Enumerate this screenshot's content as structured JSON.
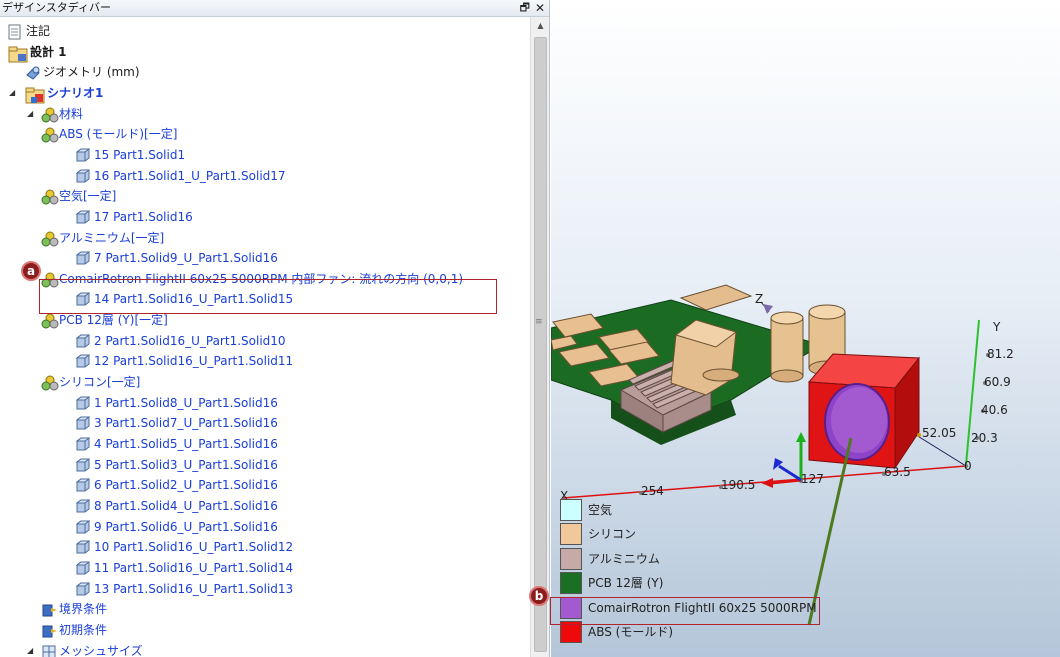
{
  "panel": {
    "title": "デザインスタディバー",
    "pin": "🗗",
    "close": "✕"
  },
  "tree": [
    {
      "label": "注記",
      "color": "black",
      "bold": false
    },
    {
      "label": "設計 1",
      "color": "black",
      "bold": true
    },
    {
      "label": "ジオメトリ (mm)",
      "color": "black",
      "bold": false
    },
    {
      "label": "シナリオ1",
      "color": "blue",
      "bold": true
    },
    {
      "label": "材料",
      "color": "blue",
      "bold": false
    },
    {
      "label": "ABS (モールド)[一定]",
      "color": "blue",
      "bold": false
    },
    {
      "label": "15 Part1.Solid1",
      "color": "blue",
      "bold": false
    },
    {
      "label": "16 Part1.Solid1_U_Part1.Solid17",
      "color": "blue",
      "bold": false
    },
    {
      "label": "空気[一定]",
      "color": "blue",
      "bold": false
    },
    {
      "label": "17 Part1.Solid16",
      "color": "blue",
      "bold": false
    },
    {
      "label": "アルミニウム[一定]",
      "color": "blue",
      "bold": false
    },
    {
      "label": "7 Part1.Solid9_U_Part1.Solid16",
      "color": "blue",
      "bold": false
    },
    {
      "label": "ComairRotron FlightII 60x25 5000RPM 内部ファン: 流れの方向 (0,0,1)",
      "color": "blue",
      "bold": false
    },
    {
      "label": "14 Part1.Solid16_U_Part1.Solid15",
      "color": "blue",
      "bold": false
    },
    {
      "label": "PCB 12層 (Y)[一定]",
      "color": "blue",
      "bold": false
    },
    {
      "label": "2 Part1.Solid16_U_Part1.Solid10",
      "color": "blue",
      "bold": false
    },
    {
      "label": "12 Part1.Solid16_U_Part1.Solid11",
      "color": "blue",
      "bold": false
    },
    {
      "label": "シリコン[一定]",
      "color": "blue",
      "bold": false
    },
    {
      "label": "1 Part1.Solid8_U_Part1.Solid16",
      "color": "blue",
      "bold": false
    },
    {
      "label": "3 Part1.Solid7_U_Part1.Solid16",
      "color": "blue",
      "bold": false
    },
    {
      "label": "4 Part1.Solid5_U_Part1.Solid16",
      "color": "blue",
      "bold": false
    },
    {
      "label": "5 Part1.Solid3_U_Part1.Solid16",
      "color": "blue",
      "bold": false
    },
    {
      "label": "6 Part1.Solid2_U_Part1.Solid16",
      "color": "blue",
      "bold": false
    },
    {
      "label": "8 Part1.Solid4_U_Part1.Solid16",
      "color": "blue",
      "bold": false
    },
    {
      "label": "9 Part1.Solid6_U_Part1.Solid16",
      "color": "blue",
      "bold": false
    },
    {
      "label": "10 Part1.Solid16_U_Part1.Solid12",
      "color": "blue",
      "bold": false
    },
    {
      "label": "11 Part1.Solid16_U_Part1.Solid14",
      "color": "blue",
      "bold": false
    },
    {
      "label": "13 Part1.Solid16_U_Part1.Solid13",
      "color": "blue",
      "bold": false
    },
    {
      "label": "境界条件",
      "color": "blue",
      "bold": false
    },
    {
      "label": "初期条件",
      "color": "blue",
      "bold": false
    },
    {
      "label": "メッシュサイズ",
      "color": "blue",
      "bold": false
    }
  ],
  "callouts": {
    "a": "a",
    "b": "b"
  },
  "axes": {
    "y_label": "Y",
    "z_label": "Z",
    "x_label": "X",
    "y_ticks": [
      "81.2",
      "60.9",
      "40.6",
      "20.3",
      "0"
    ],
    "x_ticks": [
      "254",
      "190.5",
      "127",
      "63.5"
    ],
    "z_tick": "52.05"
  },
  "legend": [
    {
      "label": "空気",
      "color": "#ccffff"
    },
    {
      "label": "シリコン",
      "color": "#f1c89a"
    },
    {
      "label": "アルミニウム",
      "color": "#c6aaa8"
    },
    {
      "label": "PCB 12層 (Y)",
      "color": "#1b6f25"
    },
    {
      "label": "ComairRotron FlightII 60x25 5000RPM",
      "color": "#a35ad0"
    },
    {
      "label": "ABS (モールド)",
      "color": "#ee0a0a"
    }
  ]
}
